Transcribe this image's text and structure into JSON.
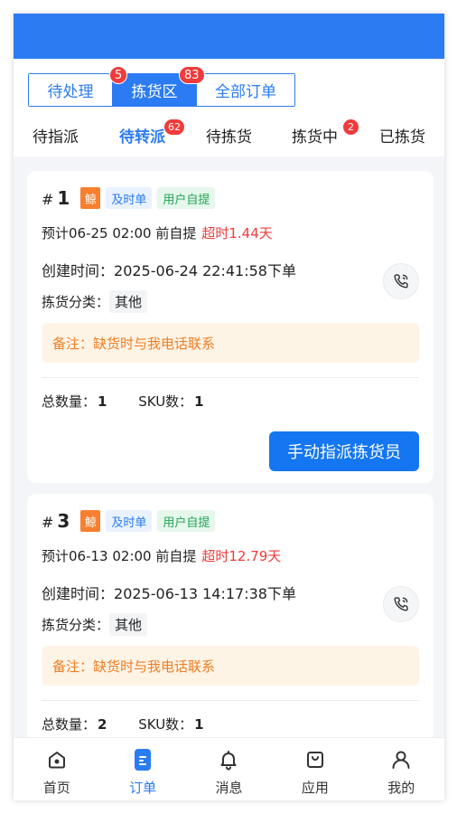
{
  "segments": [
    {
      "label": "待处理",
      "badge": ""
    },
    {
      "label": "拣货区",
      "badge": "5"
    },
    {
      "label": "全部订单",
      "badge": "83"
    }
  ],
  "subtabs": [
    {
      "label": "待指派",
      "badge": ""
    },
    {
      "label": "待转派",
      "badge": "62"
    },
    {
      "label": "待拣货",
      "badge": ""
    },
    {
      "label": "拣货中",
      "badge": "2"
    },
    {
      "label": "已拣货",
      "badge": ""
    }
  ],
  "orders": [
    {
      "hash": "#",
      "number": "1",
      "tag_orange": "鲸",
      "tag_blue": "及时单",
      "tag_green": "用户自提",
      "pickup": "预计06-25 02:00 前自提",
      "overdue": "超时1.44天",
      "created_label": "创建时间：",
      "created_value": "2025-06-24 22:41:58下单",
      "category_label": "拣货分类：",
      "category_value": "其他",
      "note": "备注：缺货时与我电话联系",
      "total_label": "总数量：",
      "total_value": "1",
      "sku_label": "SKU数：",
      "sku_value": "1",
      "action": "手动指派拣货员"
    },
    {
      "hash": "#",
      "number": "3",
      "tag_orange": "鲸",
      "tag_blue": "及时单",
      "tag_green": "用户自提",
      "pickup": "预计06-13 02:00 前自提",
      "overdue": "超时12.79天",
      "created_label": "创建时间：",
      "created_value": "2025-06-13 14:17:38下单",
      "category_label": "拣货分类：",
      "category_value": "其他",
      "note": "备注：缺货时与我电话联系",
      "total_label": "总数量：",
      "total_value": "2",
      "sku_label": "SKU数：",
      "sku_value": "1",
      "action": ""
    }
  ],
  "tabbar": [
    {
      "label": "首页",
      "icon": "home-icon"
    },
    {
      "label": "订单",
      "icon": "order-icon"
    },
    {
      "label": "消息",
      "icon": "bell-icon"
    },
    {
      "label": "应用",
      "icon": "bag-icon"
    },
    {
      "label": "我的",
      "icon": "user-icon"
    }
  ],
  "colors": {
    "primary": "#2b7bf3",
    "danger": "#ef3b3b",
    "note": "#f07d23"
  }
}
